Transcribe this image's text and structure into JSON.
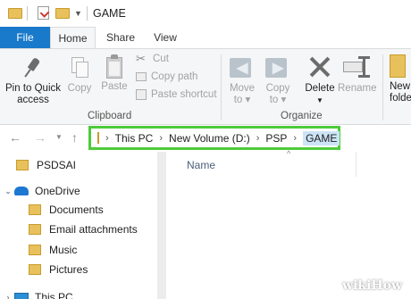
{
  "window": {
    "title": "GAME"
  },
  "tabs": {
    "file": "File",
    "home": "Home",
    "share": "Share",
    "view": "View"
  },
  "ribbon": {
    "clipboard": {
      "pin_label_1": "Pin to Quick",
      "pin_label_2": "access",
      "copy": "Copy",
      "paste": "Paste",
      "cut": "Cut",
      "copy_path": "Copy path",
      "paste_shortcut": "Paste shortcut",
      "group": "Clipboard"
    },
    "organize": {
      "move_to_1": "Move",
      "move_to_2": "to",
      "copy_to_1": "Copy",
      "copy_to_2": "to",
      "delete": "Delete",
      "rename": "Rename",
      "group": "Organize"
    },
    "new": {
      "new_folder_1": "New",
      "new_folder_2": "folde"
    }
  },
  "address": {
    "crumbs": [
      "This PC",
      "New Volume (D:)",
      "PSP",
      "GAME"
    ]
  },
  "nav_pane": {
    "items": [
      {
        "label": "PSDSAI"
      },
      {
        "label": "OneDrive"
      },
      {
        "label": "Documents"
      },
      {
        "label": "Email attachments"
      },
      {
        "label": "Music"
      },
      {
        "label": "Pictures"
      },
      {
        "label": "This PC"
      }
    ]
  },
  "content": {
    "column_name": "Name"
  },
  "watermark": {
    "text": "wikiHow"
  },
  "colors": {
    "accent": "#1979ca",
    "highlight": "#4ecb3a",
    "folder": "#e8c15d"
  }
}
